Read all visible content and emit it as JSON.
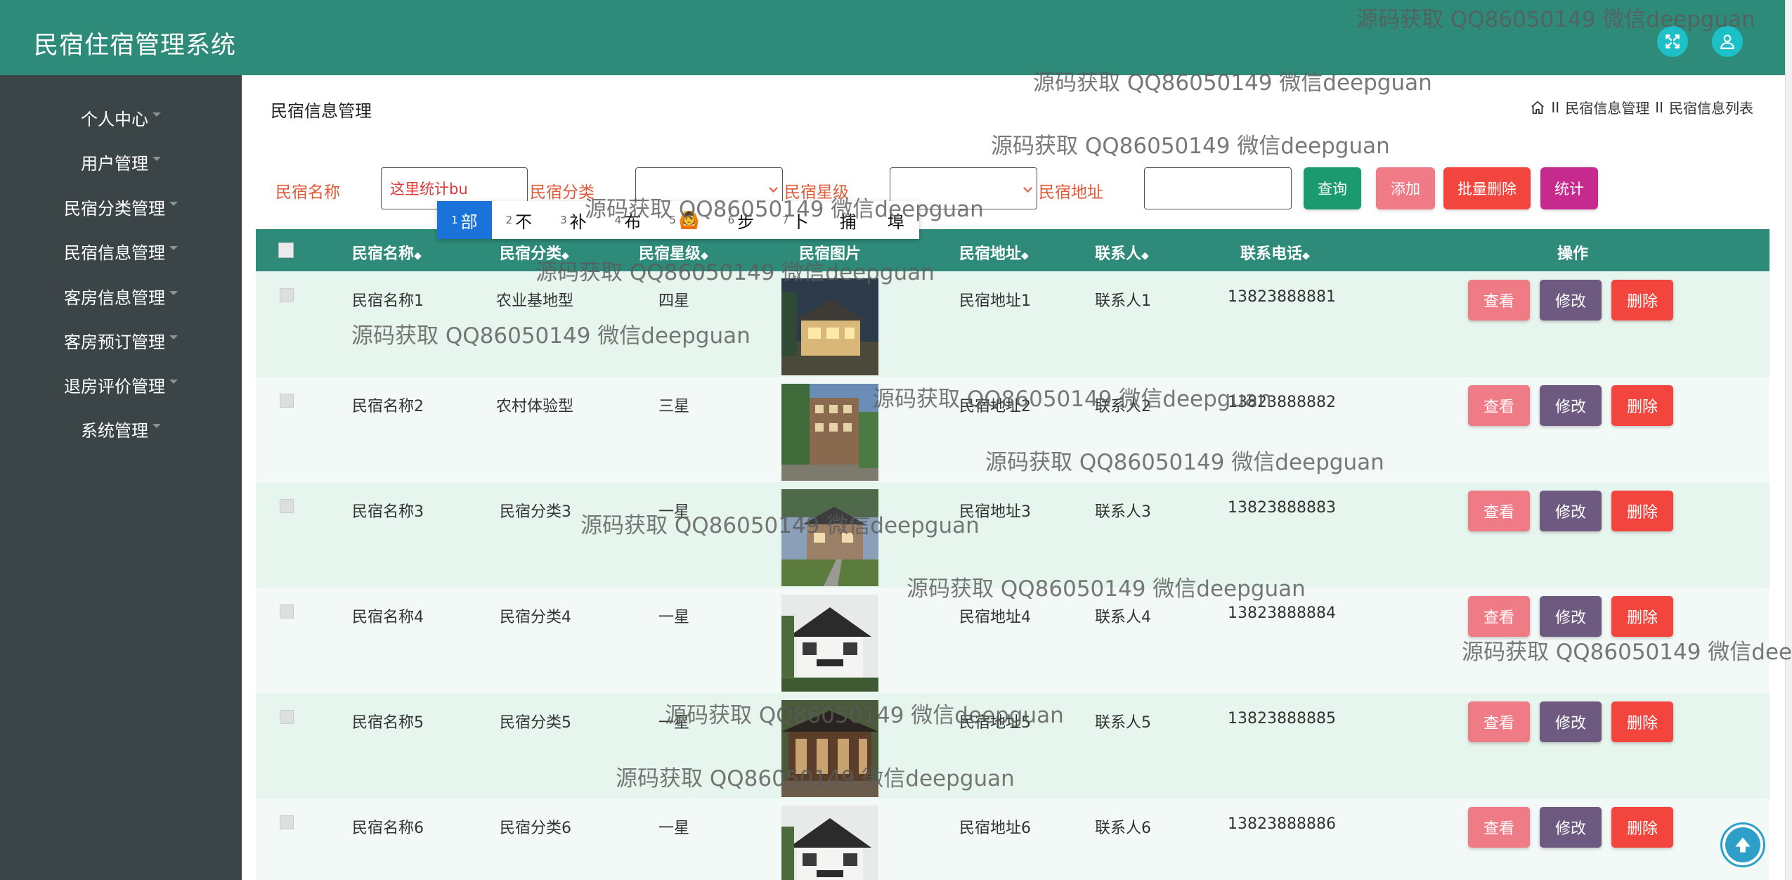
{
  "app": {
    "title": "民宿住宿管理系统"
  },
  "sidebar": {
    "items": [
      {
        "label": "个人中心"
      },
      {
        "label": "用户管理"
      },
      {
        "label": "民宿分类管理"
      },
      {
        "label": "民宿信息管理"
      },
      {
        "label": "客房信息管理"
      },
      {
        "label": "客房预订管理"
      },
      {
        "label": "退房评价管理"
      },
      {
        "label": "系统管理"
      }
    ]
  },
  "page": {
    "heading": "民宿信息管理",
    "breadcrumb": {
      "separator": "II",
      "items": [
        "民宿信息管理",
        "民宿信息列表"
      ]
    }
  },
  "filters": {
    "name_label": "民宿名称",
    "name_value": "这里统计bu",
    "category_label": "民宿分类",
    "category_value": "",
    "star_label": "民宿星级",
    "star_value": "",
    "address_label": "民宿地址",
    "address_value": ""
  },
  "actions": {
    "search": "查询",
    "add": "添加",
    "batch_delete": "批量删除",
    "stats": "统计"
  },
  "ime": {
    "candidates": [
      {
        "num": "1",
        "text": "部"
      },
      {
        "num": "2",
        "text": "不"
      },
      {
        "num": "3",
        "text": "补"
      },
      {
        "num": "4",
        "text": "布"
      },
      {
        "num": "5",
        "text": "🙆"
      },
      {
        "num": "6",
        "text": "步"
      },
      {
        "num": "7",
        "text": "卜"
      },
      {
        "num": "",
        "text": "捕"
      },
      {
        "num": "",
        "text": "埠"
      }
    ]
  },
  "table": {
    "columns": [
      "民宿名称",
      "民宿分类",
      "民宿星级",
      "民宿图片",
      "民宿地址",
      "联系人",
      "联系电话",
      "操作"
    ],
    "sort_glyph": "◆",
    "action_labels": {
      "view": "查看",
      "edit": "修改",
      "delete": "删除"
    },
    "rows": [
      {
        "name": "民宿名称1",
        "category": "农业基地型",
        "star": "四星",
        "address": "民宿地址1",
        "contact": "联系人1",
        "phone": "13823888881"
      },
      {
        "name": "民宿名称2",
        "category": "农村体验型",
        "star": "三星",
        "address": "民宿地址2",
        "contact": "联系人2",
        "phone": "13823888882"
      },
      {
        "name": "民宿名称3",
        "category": "民宿分类3",
        "star": "一星",
        "address": "民宿地址3",
        "contact": "联系人3",
        "phone": "13823888883"
      },
      {
        "name": "民宿名称4",
        "category": "民宿分类4",
        "star": "一星",
        "address": "民宿地址4",
        "contact": "联系人4",
        "phone": "13823888884"
      },
      {
        "name": "民宿名称5",
        "category": "民宿分类5",
        "star": "一星",
        "address": "民宿地址5",
        "contact": "联系人5",
        "phone": "13823888885"
      },
      {
        "name": "民宿名称6",
        "category": "民宿分类6",
        "star": "一星",
        "address": "民宿地址6",
        "contact": "联系人6",
        "phone": "13823888886"
      }
    ]
  },
  "watermark": {
    "text": "源码获取 QQ86050149 微信deepguan"
  },
  "colors": {
    "header": "#2e8b7a",
    "sidebar": "#3b4446",
    "search_button": "#1a9a6e",
    "add_button": "#ef7b86",
    "batch_delete_button": "#f2453e",
    "stats_button": "#c72a8e",
    "edit_button": "#6e5a80"
  }
}
